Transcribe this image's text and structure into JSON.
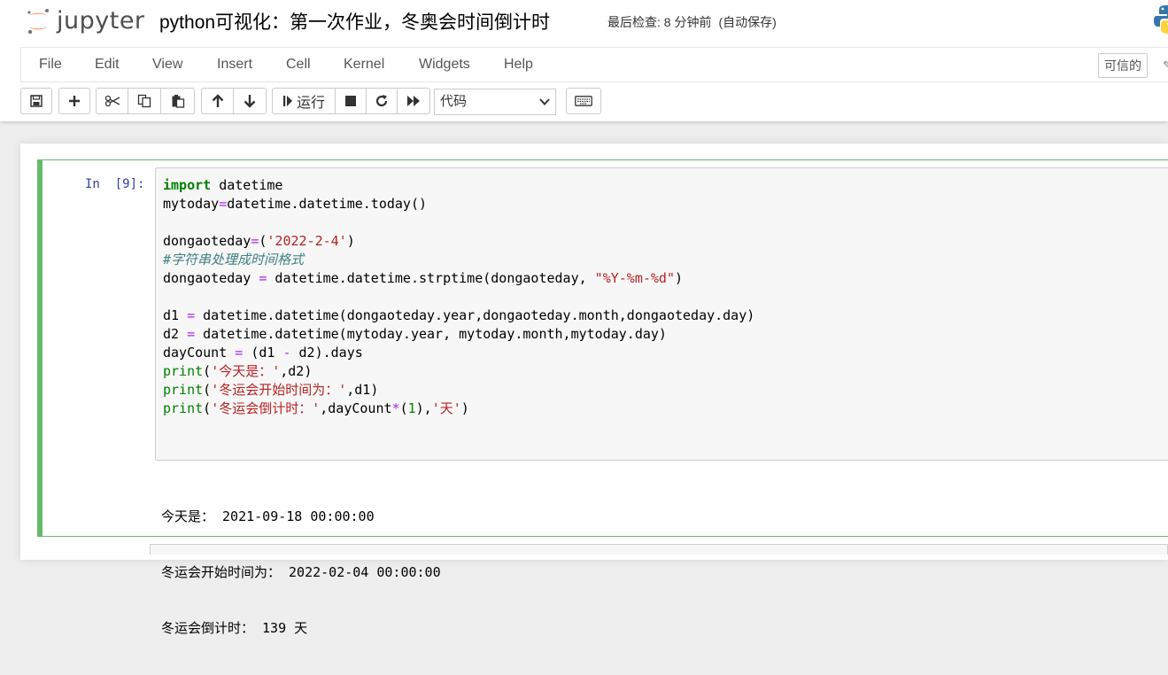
{
  "header": {
    "logo_text": "jupyter",
    "notebook_title": "python可视化：第一次作业，冬奥会时间倒计时",
    "checkpoint": "最后检查: 8 分钟前",
    "autosave": "(自动保存)"
  },
  "menu": {
    "items": [
      "File",
      "Edit",
      "View",
      "Insert",
      "Cell",
      "Kernel",
      "Widgets",
      "Help"
    ],
    "trusted": "可信的"
  },
  "toolbar": {
    "run_label": "运行",
    "cell_type": "代码"
  },
  "cell": {
    "prompt": "In  [9]:",
    "code_lines": [
      [
        {
          "t": "import",
          "c": "kw"
        },
        {
          "t": " datetime"
        }
      ],
      [
        {
          "t": "mytoday"
        },
        {
          "t": "=",
          "c": "op"
        },
        {
          "t": "datetime.datetime.today()"
        }
      ],
      [
        {
          "t": ""
        }
      ],
      [
        {
          "t": "dongaoteday"
        },
        {
          "t": "=",
          "c": "op"
        },
        {
          "t": "("
        },
        {
          "t": "'2022-2-4'",
          "c": "str"
        },
        {
          "t": ")"
        }
      ],
      [
        {
          "t": "#字符串处理成时间格式",
          "c": "cmt"
        }
      ],
      [
        {
          "t": "dongaoteday "
        },
        {
          "t": "=",
          "c": "op"
        },
        {
          "t": " datetime.datetime.strptime(dongaoteday, "
        },
        {
          "t": "\"%Y-%m-%d\"",
          "c": "str"
        },
        {
          "t": ")"
        }
      ],
      [
        {
          "t": ""
        }
      ],
      [
        {
          "t": "d1 "
        },
        {
          "t": "=",
          "c": "op"
        },
        {
          "t": " datetime.datetime(dongaoteday.year,dongaoteday.month,dongaoteday.day)"
        }
      ],
      [
        {
          "t": "d2 "
        },
        {
          "t": "=",
          "c": "op"
        },
        {
          "t": " datetime.datetime(mytoday.year, mytoday.month,mytoday.day)"
        }
      ],
      [
        {
          "t": "dayCount "
        },
        {
          "t": "=",
          "c": "op"
        },
        {
          "t": " (d1 "
        },
        {
          "t": "-",
          "c": "op"
        },
        {
          "t": " d2).days"
        }
      ],
      [
        {
          "t": "print",
          "c": "bi"
        },
        {
          "t": "("
        },
        {
          "t": "'今天是：'",
          "c": "str"
        },
        {
          "t": ",d2)"
        }
      ],
      [
        {
          "t": "print",
          "c": "bi"
        },
        {
          "t": "("
        },
        {
          "t": "'冬运会开始时间为：'",
          "c": "str"
        },
        {
          "t": ",d1)"
        }
      ],
      [
        {
          "t": "print",
          "c": "bi"
        },
        {
          "t": "("
        },
        {
          "t": "'冬运会倒计时：'",
          "c": "str"
        },
        {
          "t": ",dayCount"
        },
        {
          "t": "*",
          "c": "op"
        },
        {
          "t": "("
        },
        {
          "t": "1",
          "c": "num"
        },
        {
          "t": "),"
        },
        {
          "t": "'天'",
          "c": "str"
        },
        {
          "t": ")"
        }
      ]
    ],
    "output_lines": [
      "今天是： 2021-09-18 00:00:00",
      "冬运会开始时间为： 2022-02-04 00:00:00",
      "冬运会倒计时： 139 天"
    ]
  }
}
